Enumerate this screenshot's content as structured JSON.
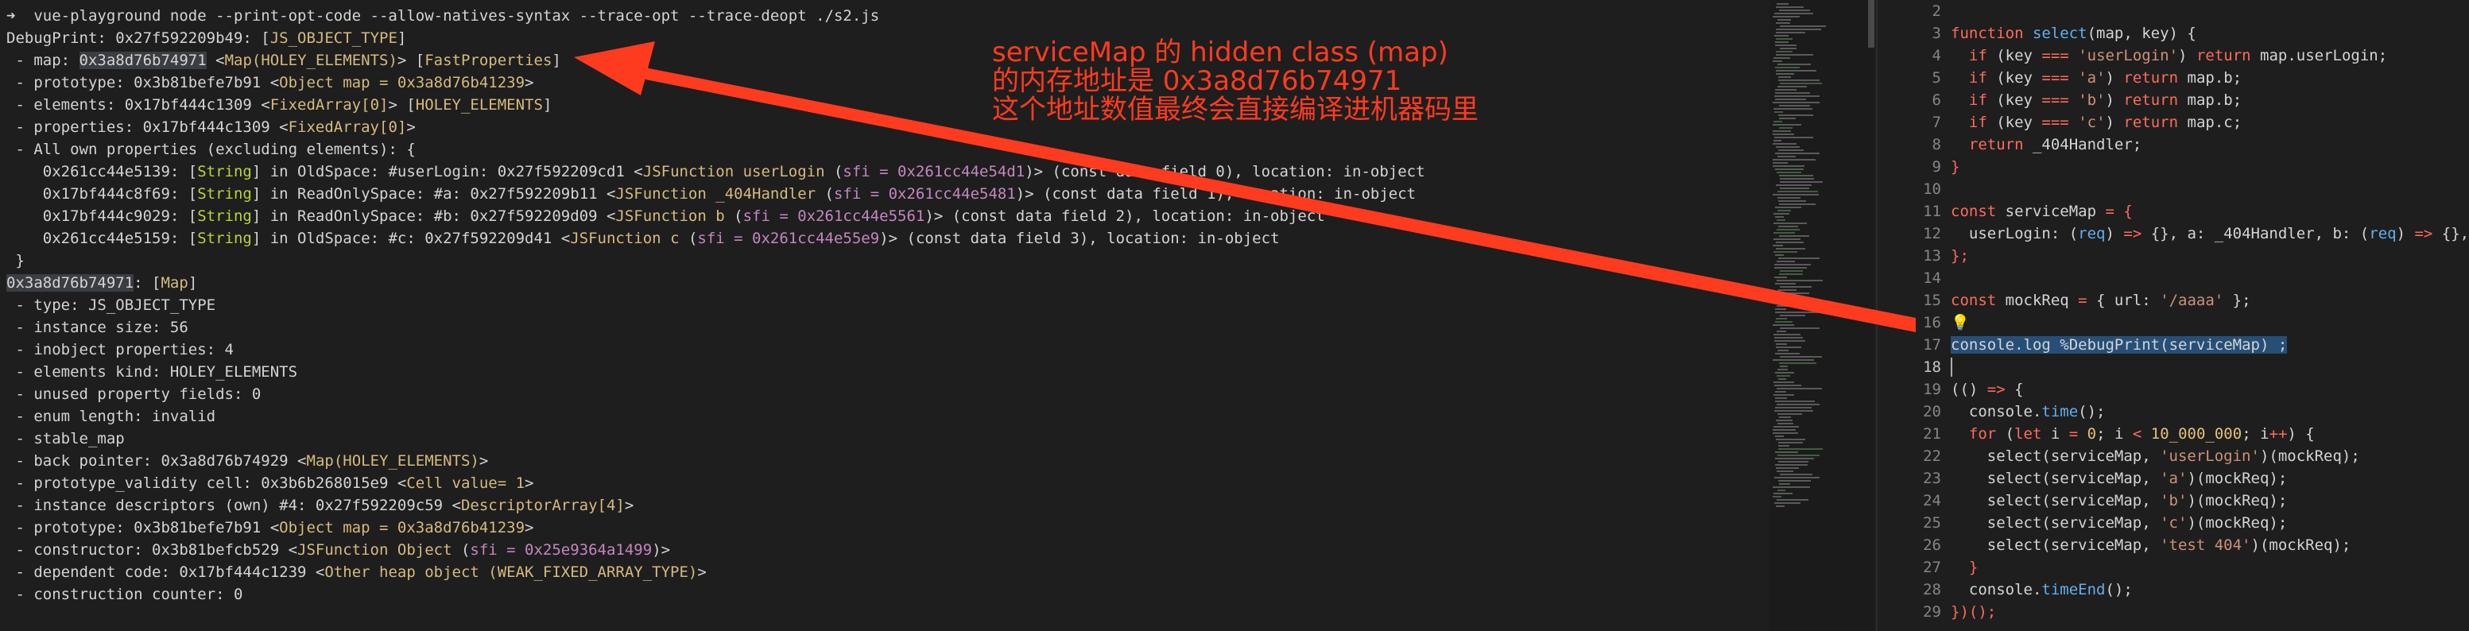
{
  "terminal": {
    "lines": [
      [
        {
          "t": "➜  vue-playground node --print-opt-code --allow-natives-syntax --trace-opt --trace-deopt ./s2.js"
        }
      ],
      [
        {
          "t": "DebugPrint: 0x27f592209b49: ["
        },
        {
          "t": "JS_OBJECT_TYPE",
          "c": "y"
        },
        {
          "t": "]"
        }
      ],
      [
        {
          "t": " - map: "
        },
        {
          "t": "0x3a8d76b74971",
          "c": "hl"
        },
        {
          "t": " <"
        },
        {
          "t": "Map(HOLEY_ELEMENTS)",
          "c": "y"
        },
        {
          "t": "> ["
        },
        {
          "t": "FastProperties",
          "c": "y"
        },
        {
          "t": "]"
        }
      ],
      [
        {
          "t": " - prototype: 0x3b81befe7b91 <"
        },
        {
          "t": "Object map = 0x3a8d76b41239",
          "c": "y"
        },
        {
          "t": ">"
        }
      ],
      [
        {
          "t": " - elements: 0x17bf444c1309 <"
        },
        {
          "t": "FixedArray[0]",
          "c": "y"
        },
        {
          "t": "> ["
        },
        {
          "t": "HOLEY_ELEMENTS",
          "c": "y"
        },
        {
          "t": "]"
        }
      ],
      [
        {
          "t": " - properties: 0x17bf444c1309 <"
        },
        {
          "t": "FixedArray[0]",
          "c": "y"
        },
        {
          "t": ">"
        }
      ],
      [
        {
          "t": " - All own properties (excluding elements): {"
        }
      ],
      [
        {
          "t": "    0x261cc44e5139: ["
        },
        {
          "t": "String",
          "c": "g"
        },
        {
          "t": "] in OldSpace: #userLogin: 0x27f592209cd1 <"
        },
        {
          "t": "JSFunction userLogin",
          "c": "y"
        },
        {
          "t": " ("
        },
        {
          "t": "sfi = 0x261cc44e54d1",
          "c": "p"
        },
        {
          "t": ")> (const data field 0), location: in-object"
        }
      ],
      [
        {
          "t": "    0x17bf444c8f69: ["
        },
        {
          "t": "String",
          "c": "g"
        },
        {
          "t": "] in ReadOnlySpace: #a: 0x27f592209b11 <"
        },
        {
          "t": "JSFunction _404Handler",
          "c": "y"
        },
        {
          "t": " ("
        },
        {
          "t": "sfi = 0x261cc44e5481",
          "c": "p"
        },
        {
          "t": ")> (const data field 1), location: in-object"
        }
      ],
      [
        {
          "t": "    0x17bf444c9029: ["
        },
        {
          "t": "String",
          "c": "g"
        },
        {
          "t": "] in ReadOnlySpace: #b: 0x27f592209d09 <"
        },
        {
          "t": "JSFunction b",
          "c": "y"
        },
        {
          "t": " ("
        },
        {
          "t": "sfi = 0x261cc44e5561",
          "c": "p"
        },
        {
          "t": ")> (const data field 2), location: in-object"
        }
      ],
      [
        {
          "t": "    0x261cc44e5159: ["
        },
        {
          "t": "String",
          "c": "g"
        },
        {
          "t": "] in OldSpace: #c: 0x27f592209d41 <"
        },
        {
          "t": "JSFunction c",
          "c": "y"
        },
        {
          "t": " ("
        },
        {
          "t": "sfi = 0x261cc44e55e9",
          "c": "p"
        },
        {
          "t": ")> (const data field 3), location: in-object"
        }
      ],
      [
        {
          "t": " }"
        }
      ],
      [
        {
          "t": "0x3a8d76b74971",
          "c": "hl"
        },
        {
          "t": ": ["
        },
        {
          "t": "Map",
          "c": "y"
        },
        {
          "t": "]"
        }
      ],
      [
        {
          "t": " - type: JS_OBJECT_TYPE"
        }
      ],
      [
        {
          "t": " - instance size: 56"
        }
      ],
      [
        {
          "t": " - inobject properties: 4"
        }
      ],
      [
        {
          "t": " - elements kind: HOLEY_ELEMENTS"
        }
      ],
      [
        {
          "t": " - unused property fields: 0"
        }
      ],
      [
        {
          "t": " - enum length: invalid"
        }
      ],
      [
        {
          "t": " - stable_map"
        }
      ],
      [
        {
          "t": " - back pointer: 0x3a8d76b74929 <"
        },
        {
          "t": "Map(HOLEY_ELEMENTS)",
          "c": "y"
        },
        {
          "t": ">"
        }
      ],
      [
        {
          "t": " - prototype_validity cell: 0x3b6b268015e9 <"
        },
        {
          "t": "Cell value= 1",
          "c": "y"
        },
        {
          "t": ">"
        }
      ],
      [
        {
          "t": " - instance descriptors (own) #4: 0x27f592209c59 <"
        },
        {
          "t": "DescriptorArray[4]",
          "c": "y"
        },
        {
          "t": ">"
        }
      ],
      [
        {
          "t": " - prototype: 0x3b81befe7b91 <"
        },
        {
          "t": "Object map = 0x3a8d76b41239",
          "c": "y"
        },
        {
          "t": ">"
        }
      ],
      [
        {
          "t": " - constructor: 0x3b81befcb529 <"
        },
        {
          "t": "JSFunction Object",
          "c": "y"
        },
        {
          "t": " ("
        },
        {
          "t": "sfi = 0x25e9364a1499",
          "c": "p"
        },
        {
          "t": ")>"
        }
      ],
      [
        {
          "t": " - dependent code: 0x17bf444c1239 <"
        },
        {
          "t": "Other heap object (WEAK_FIXED_ARRAY_TYPE)",
          "c": "y"
        },
        {
          "t": ">"
        }
      ],
      [
        {
          "t": " - construction counter: 0"
        }
      ]
    ]
  },
  "annotation": {
    "line1": "serviceMap 的 hidden class (map)",
    "line2": "的内存地址是 0x3a8d76b74971",
    "line3": "这个地址数值最终会直接编译进机器码里"
  },
  "editor": {
    "first_line": 2,
    "current_line": 18,
    "selected_line": 17,
    "lines": [
      [],
      [
        {
          "t": "function ",
          "c": "kw"
        },
        {
          "t": "select",
          "c": "fn"
        },
        {
          "t": "(map, key) {"
        }
      ],
      [
        {
          "t": "  "
        },
        {
          "t": "if",
          "c": "kw"
        },
        {
          "t": " (key "
        },
        {
          "t": "===",
          "c": "kw"
        },
        {
          "t": " "
        },
        {
          "t": "'userLogin'",
          "c": "str"
        },
        {
          "t": ") "
        },
        {
          "t": "return",
          "c": "kw"
        },
        {
          "t": " map.userLogin;"
        }
      ],
      [
        {
          "t": "  "
        },
        {
          "t": "if",
          "c": "kw"
        },
        {
          "t": " (key "
        },
        {
          "t": "===",
          "c": "kw"
        },
        {
          "t": " "
        },
        {
          "t": "'a'",
          "c": "str"
        },
        {
          "t": ") "
        },
        {
          "t": "return",
          "c": "kw"
        },
        {
          "t": " map.b;"
        }
      ],
      [
        {
          "t": "  "
        },
        {
          "t": "if",
          "c": "kw"
        },
        {
          "t": " (key "
        },
        {
          "t": "===",
          "c": "kw"
        },
        {
          "t": " "
        },
        {
          "t": "'b'",
          "c": "str"
        },
        {
          "t": ") "
        },
        {
          "t": "return",
          "c": "kw"
        },
        {
          "t": " map.b;"
        }
      ],
      [
        {
          "t": "  "
        },
        {
          "t": "if",
          "c": "kw"
        },
        {
          "t": " (key "
        },
        {
          "t": "===",
          "c": "kw"
        },
        {
          "t": " "
        },
        {
          "t": "'c'",
          "c": "str"
        },
        {
          "t": ") "
        },
        {
          "t": "return",
          "c": "kw"
        },
        {
          "t": " map.c;"
        }
      ],
      [
        {
          "t": "  "
        },
        {
          "t": "return",
          "c": "kw"
        },
        {
          "t": " _404Handler;"
        }
      ],
      [
        {
          "t": "}",
          "c": "kw"
        }
      ],
      [],
      [
        {
          "t": "const",
          "c": "kw"
        },
        {
          "t": " serviceMap "
        },
        {
          "t": "=",
          "c": "kw"
        },
        {
          "t": " {",
          "c": "kw"
        }
      ],
      [
        {
          "t": "  userLogin: ("
        },
        {
          "t": "req",
          "c": "fn"
        },
        {
          "t": ") "
        },
        {
          "t": "=>",
          "c": "kw"
        },
        {
          "t": " {}, a: _404Handler, b: ("
        },
        {
          "t": "req",
          "c": "fn"
        },
        {
          "t": ") "
        },
        {
          "t": "=>",
          "c": "kw"
        },
        {
          "t": " {}, c"
        }
      ],
      [
        {
          "t": "};",
          "c": "kw"
        }
      ],
      [],
      [
        {
          "t": "const",
          "c": "kw"
        },
        {
          "t": " mockReq "
        },
        {
          "t": "=",
          "c": "kw"
        },
        {
          "t": " { url: "
        },
        {
          "t": "'/aaaa'",
          "c": "str"
        },
        {
          "t": " };"
        }
      ],
      [
        {
          "t": "💡"
        }
      ],
      [
        {
          "t": "console.",
          "c": "sel"
        },
        {
          "t": "log",
          "c": "sel"
        },
        {
          "t": " ",
          "c": "sel"
        },
        {
          "t": "%DebugPrint",
          "c": "sel"
        },
        {
          "t": "(serviceMap) ;",
          "c": "sel"
        }
      ],
      [],
      [
        {
          "t": "(() "
        },
        {
          "t": "=>",
          "c": "kw"
        },
        {
          "t": " {"
        }
      ],
      [
        {
          "t": "  console."
        },
        {
          "t": "time",
          "c": "fn"
        },
        {
          "t": "();"
        }
      ],
      [
        {
          "t": "  "
        },
        {
          "t": "for",
          "c": "kw"
        },
        {
          "t": " ("
        },
        {
          "t": "let",
          "c": "kw"
        },
        {
          "t": " i "
        },
        {
          "t": "=",
          "c": "kw"
        },
        {
          "t": " "
        },
        {
          "t": "0",
          "c": "num"
        },
        {
          "t": "; i "
        },
        {
          "t": "<",
          "c": "kw"
        },
        {
          "t": " "
        },
        {
          "t": "10_000_000",
          "c": "num"
        },
        {
          "t": "; i"
        },
        {
          "t": "++",
          "c": "kw"
        },
        {
          "t": ") {"
        }
      ],
      [
        {
          "t": "    select(serviceMap, "
        },
        {
          "t": "'userLogin'",
          "c": "str"
        },
        {
          "t": ")(mockReq);"
        }
      ],
      [
        {
          "t": "    select(serviceMap, "
        },
        {
          "t": "'a'",
          "c": "str"
        },
        {
          "t": ")(mockReq);"
        }
      ],
      [
        {
          "t": "    select(serviceMap, "
        },
        {
          "t": "'b'",
          "c": "str"
        },
        {
          "t": ")(mockReq);"
        }
      ],
      [
        {
          "t": "    select(serviceMap, "
        },
        {
          "t": "'c'",
          "c": "str"
        },
        {
          "t": ")(mockReq);"
        }
      ],
      [
        {
          "t": "    select(serviceMap, "
        },
        {
          "t": "'test 404'",
          "c": "str"
        },
        {
          "t": ")(mockReq);"
        }
      ],
      [
        {
          "t": "  }",
          "c": "kw"
        }
      ],
      [
        {
          "t": "  console."
        },
        {
          "t": "timeEnd",
          "c": "fn"
        },
        {
          "t": "();"
        }
      ],
      [
        {
          "t": "})();",
          "c": "kw"
        }
      ]
    ]
  },
  "colors": {
    "accent": "#ff3b1f",
    "selection": "#264f78"
  }
}
